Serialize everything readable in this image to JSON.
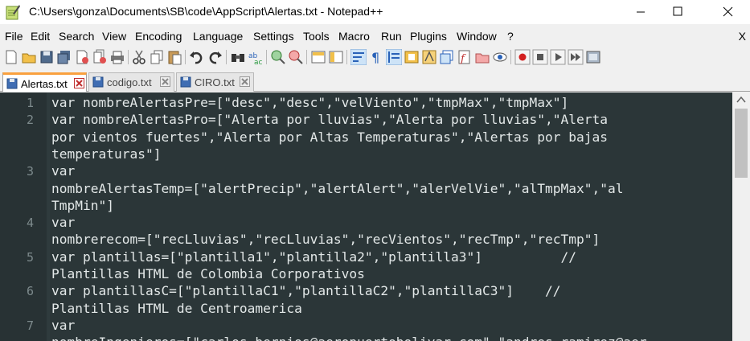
{
  "window": {
    "title": "C:\\Users\\gonza\\Documents\\SB\\code\\AppScript\\Alertas.txt - Notepad++"
  },
  "menu": [
    "File",
    "Edit",
    "Search",
    "View",
    "Encoding",
    "Language",
    "Settings",
    "Tools",
    "Macro",
    "Run",
    "Plugins",
    "Window",
    "?"
  ],
  "menu_close": "X",
  "tabs": [
    {
      "label": "Alertas.txt",
      "active": true
    },
    {
      "label": "codigo.txt",
      "active": false
    },
    {
      "label": "CIRO.txt",
      "active": false
    }
  ],
  "editor": {
    "lines": [
      {
        "num": "1",
        "text": "var nombreAlertasPre=[\"desc\",\"desc\",\"velViento\",\"tmpMax\",\"tmpMax\"]"
      },
      {
        "num": "2",
        "text": "var nombreAlertasPro=[\"Alerta por lluvias\",\"Alerta por lluvias\",\"Alerta"
      },
      {
        "num": "",
        "text": "por vientos fuertes\",\"Alerta por Altas Temperaturas\",\"Alertas por bajas"
      },
      {
        "num": "",
        "text": "temperaturas\"]"
      },
      {
        "num": "3",
        "text": "var"
      },
      {
        "num": "",
        "text": "nombreAlertasTemp=[\"alertPrecip\",\"alertAlert\",\"alerVelVie\",\"alTmpMax\",\"al"
      },
      {
        "num": "",
        "text": "TmpMin\"]"
      },
      {
        "num": "4",
        "text": "var"
      },
      {
        "num": "",
        "text": "nombrerecom=[\"recLluvias\",\"recLluvias\",\"recVientos\",\"recTmp\",\"recTmp\"]"
      },
      {
        "num": "5",
        "text": "var plantillas=[\"plantilla1\",\"plantilla2\",\"plantilla3\"]          //"
      },
      {
        "num": "",
        "text": "Plantillas HTML de Colombia Corporativos"
      },
      {
        "num": "6",
        "text": "var plantillasC=[\"plantillaC1\",\"plantillaC2\",\"plantillaC3\"]    //"
      },
      {
        "num": "",
        "text": "Plantillas HTML de Centroamerica"
      },
      {
        "num": "7",
        "text": "var"
      },
      {
        "num": "",
        "text": "nombreIngenieros=[\"carlos.bernios@aeropuertobolivar.com\",\"andres.ramirez@aer"
      }
    ]
  },
  "colors": {
    "editor_bg": "#2b3638",
    "gutter_bg": "#283234",
    "text": "#e3e8e8",
    "line_number": "#7d8a8c",
    "active_tab_accent": "#f9a03f"
  },
  "toolbar_icons": [
    "new-file-icon",
    "open-file-icon",
    "save-icon",
    "save-all-icon",
    "close-icon",
    "close-all-icon",
    "print-icon",
    "cut-icon",
    "copy-icon",
    "paste-icon",
    "undo-icon",
    "redo-icon",
    "find-icon",
    "replace-icon",
    "zoom-in-icon",
    "zoom-out-icon",
    "sync-vertical-icon",
    "sync-horizontal-icon",
    "word-wrap-icon",
    "show-all-chars-icon",
    "indent-guide-icon",
    "doc-map-icon",
    "function-list-icon",
    "folder-workspace-icon",
    "monitoring-icon",
    "doc-switcher-icon",
    "eye-icon",
    "record-macro-icon",
    "stop-record-icon",
    "play-macro-icon",
    "run-macro-multiple-icon",
    "save-macro-icon"
  ]
}
